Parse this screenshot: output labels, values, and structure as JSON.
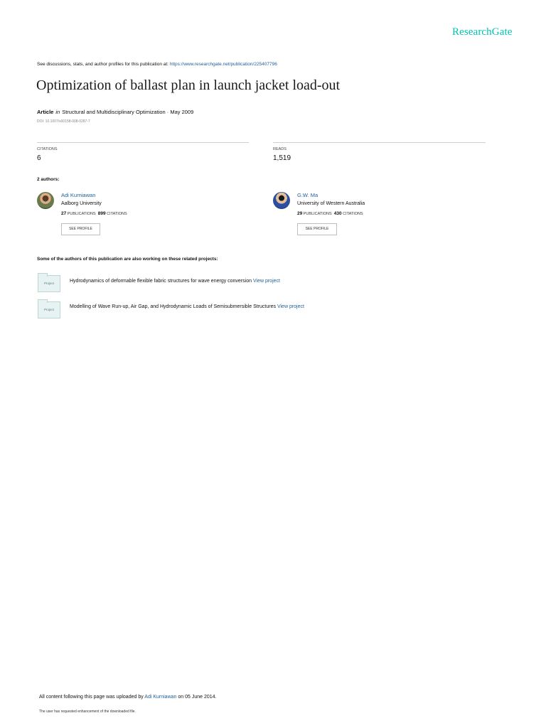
{
  "brand": "ResearchGate",
  "disclaimer": {
    "prefix": "See discussions, stats, and author profiles for this publication at:",
    "url": "https://www.researchgate.net/publication/225407796"
  },
  "title": "Optimization of ballast plan in launch jacket load-out",
  "meta": {
    "type": "Article",
    "in": "in",
    "journal": "Structural and Multidisciplinary Optimization · May 2009",
    "doi": "DOI: 10.1007/s00158-008-0287-7"
  },
  "stats": {
    "citations_label": "CITATIONS",
    "citations_value": "6",
    "reads_label": "READS",
    "reads_value": "1,519"
  },
  "authors_heading": "2 authors:",
  "authors": [
    {
      "name": "Adi Kurniawan",
      "affiliation": "Aalborg University",
      "publications": "27",
      "publications_label": "PUBLICATIONS",
      "citations": "899",
      "citations_label": "CITATIONS",
      "button": "SEE PROFILE"
    },
    {
      "name": "G.W. Ma",
      "affiliation": "University of Western Australia",
      "publications": "29",
      "publications_label": "PUBLICATIONS",
      "citations": "430",
      "citations_label": "CITATIONS",
      "button": "SEE PROFILE"
    }
  ],
  "projects_heading": "Some of the authors of this publication are also working on these related projects:",
  "projects": [
    {
      "icon_label": "Project",
      "text": "Hydrodynamics of deformable flexible fabric structures for wave energy conversion",
      "link": "View project"
    },
    {
      "icon_label": "Project",
      "text": "Modelling of Wave Run-up, Air Gap, and Hydrodynamic Loads of Semisubmersible Structures",
      "link": "View project"
    }
  ],
  "footer": {
    "prefix": "All content following this page was uploaded by",
    "uploader": "Adi Kurniawan",
    "suffix": "on 05 June 2014.",
    "note": "The user has requested enhancement of the downloaded file."
  },
  "colors": {
    "brand": "#00c2b2",
    "link": "#1f5f9a"
  }
}
